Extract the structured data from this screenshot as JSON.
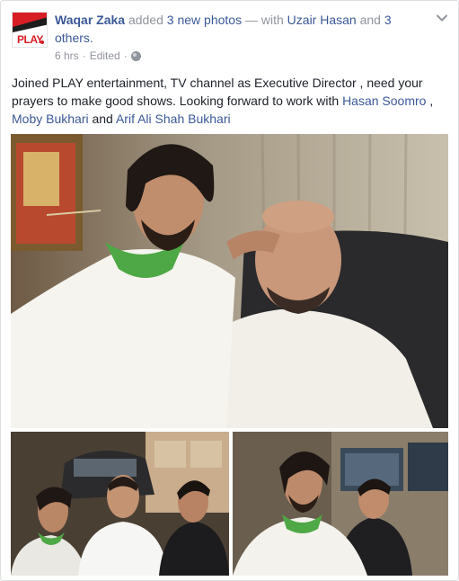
{
  "post": {
    "author": "Waqar Zaka",
    "action_prefix": " added ",
    "photos_link": "3 new photos",
    "with_text": " — with ",
    "tagged_person": "Uzair Hasan",
    "and_text": " and ",
    "others_link": "3 others.",
    "timestamp": "6 hrs",
    "separator": " · ",
    "edited_label": "Edited",
    "privacy_icon": "globe-icon",
    "options_icon": "chevron-down-icon",
    "text_part1": "Joined PLAY entertainment, TV channel as Executive Director , need your prayers to make good shows. Looking forward to work with ",
    "mention1": "Hasan Soomro",
    "text_part2": " , ",
    "mention2": "Moby Bukhari",
    "text_part3": " and ",
    "mention3": "Arif Ali Shah Bukhari"
  },
  "avatar": {
    "logo_text": "PLAY",
    "brand_red": "#d81e25"
  },
  "colors": {
    "link": "#3b5998",
    "meta": "#90949c",
    "text": "#1d2129"
  },
  "photos": [
    {
      "name": "photo-main"
    },
    {
      "name": "photo-bottom-left"
    },
    {
      "name": "photo-bottom-right"
    }
  ]
}
